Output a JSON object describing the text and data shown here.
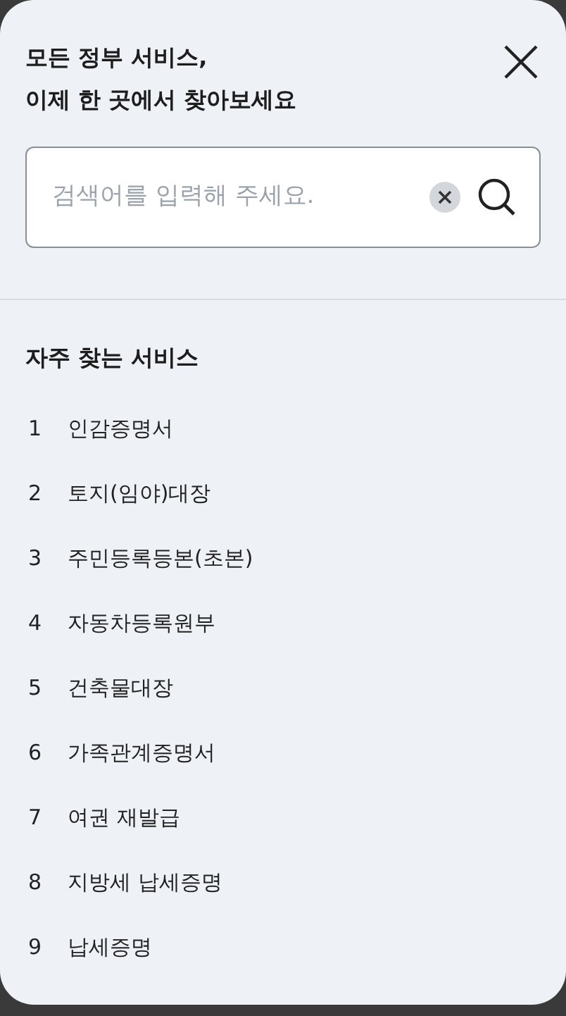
{
  "header": {
    "title_lines": [
      "모든 정부 서비스,",
      "이제 한 곳에서 찾아보세요"
    ]
  },
  "search": {
    "placeholder": "검색어를 입력해 주세요."
  },
  "popular": {
    "heading": "자주 찾는 서비스",
    "items": [
      {
        "rank": "1",
        "label": "인감증명서"
      },
      {
        "rank": "2",
        "label": "토지(임야)대장"
      },
      {
        "rank": "3",
        "label": "주민등록등본(초본)"
      },
      {
        "rank": "4",
        "label": "자동차등록원부"
      },
      {
        "rank": "5",
        "label": "건축물대장"
      },
      {
        "rank": "6",
        "label": "가족관계증명서"
      },
      {
        "rank": "7",
        "label": "여권 재발급"
      },
      {
        "rank": "8",
        "label": "지방세 납세증명"
      },
      {
        "rank": "9",
        "label": "납세증명"
      }
    ]
  }
}
